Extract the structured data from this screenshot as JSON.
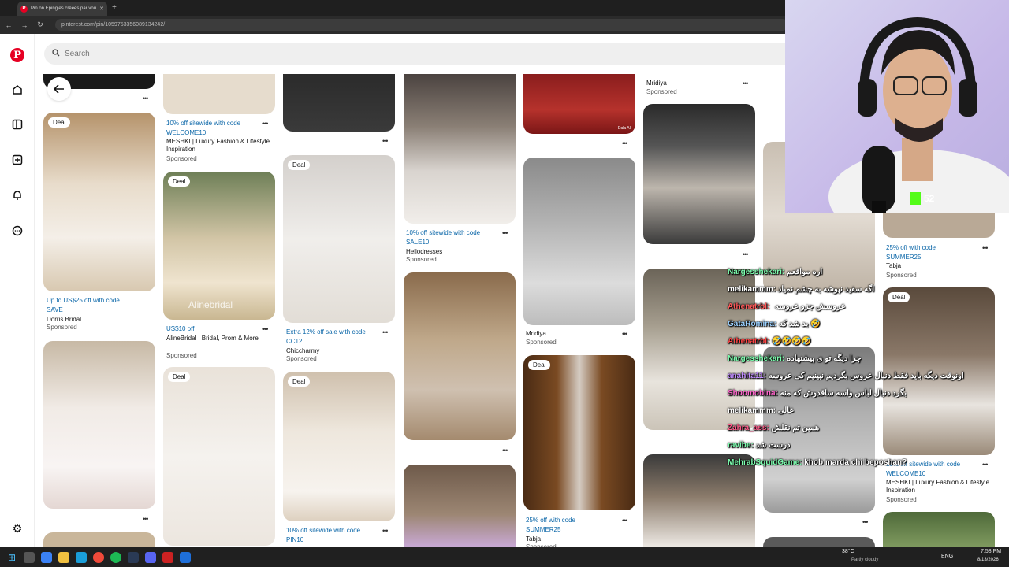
{
  "browser": {
    "tab_title": "Pin on Épingles créées par vous",
    "url": "pinterest.com/pin/1059753356089134242/"
  },
  "search": {
    "placeholder": "Search"
  },
  "pins": [
    {
      "badge": "Deal",
      "promo": "Up to US$25 off with code",
      "code": "SAVE",
      "name": "Dorris Bridal",
      "sponsored": "Sponsored"
    },
    {
      "promo": "10% off sitewide with code",
      "code": "WELCOME10",
      "name": "MESHKI | Luxury Fashion & Lifestyle Inspiration",
      "sponsored": "Sponsored"
    },
    {
      "badge": "Deal",
      "promo": "US$10 off",
      "name": "AlineBridal | Bridal, Prom & More",
      "sponsored": "Sponsored",
      "watermark": "Alinebridal"
    },
    {
      "badge": "Deal",
      "promo": "Extra 12% off sale with code",
      "code": "CC12",
      "name": "Chiccharmy",
      "sponsored": "Sponsored"
    },
    {
      "badge": "Deal"
    },
    {
      "badge": "Deal",
      "promo": "10% off sitewide with code",
      "code": "PIN10"
    },
    {
      "promo": "10% off sitewide with code",
      "code": "SALE10",
      "name": "Hellodresses",
      "sponsored": "Sponsored"
    },
    {
      "name": "Mridiya",
      "sponsored": "Sponsored",
      "watermark": "Dala AI"
    },
    {
      "name": "Mridiya",
      "sponsored": "Sponsored"
    },
    {
      "badge": "Deal",
      "promo": "25% off with code",
      "code": "SUMMER25",
      "name": "Tabja",
      "sponsored": "Sponsored"
    },
    {
      "promo": "25% off with code",
      "code": "SUMMER25",
      "name": "Tabja",
      "sponsored": "Sponsored"
    },
    {
      "badge": "Deal",
      "promo": "10% off sitewide with code",
      "code": "WELCOME10",
      "name": "MESHKI | Luxury Fashion & Lifestyle Inspiration",
      "sponsored": "Sponsored"
    }
  ],
  "webcam": {
    "badge": "52"
  },
  "chat": [
    {
      "user": "Nargesshekari:",
      "msg": "اره مواقعم",
      "color": "#7dffb0"
    },
    {
      "user": "melikammm:",
      "msg": "اگه سفید نپوشه به چشم نمیاد",
      "color": "#ffffff"
    },
    {
      "user": "",
      "msg": "عروسش جزو عروسه",
      "color": "#ffffff"
    },
    {
      "user": "Athenatrbl:",
      "msg": "",
      "color": "#ff5a5a"
    },
    {
      "user": "GataRomina:",
      "msg": "بد شد که",
      "color": "#9ad0ff"
    },
    {
      "user": "Athenatrbl:",
      "msg": "",
      "color": "#ff4444"
    },
    {
      "user": "Nargesshekari:",
      "msg": "چرا دیگه تو ی پیشنهاده",
      "color": "#7dffb0"
    },
    {
      "user": "anahita11:",
      "msg": "اونوقت دیگه باید فقط دنبال عروس بگردیم نبینیم کی عروسه",
      "color": "#c08cff"
    },
    {
      "user": "Shoomobina:",
      "msg": "بگرد دنبال لباس واسه ساقدوش که منه",
      "color": "#ff66cc"
    },
    {
      "user": "melikammm:",
      "msg": "عالی",
      "color": "#ffffff"
    },
    {
      "user": "Zahra_ass:",
      "msg": "همین تم نقلش",
      "color": "#ff5a8a"
    },
    {
      "user": "ravibe:",
      "msg": "درست شد",
      "color": "#7dffb0"
    },
    {
      "user": "MehrabSquidGame:",
      "msg": "khob marda chi beposhan?",
      "color": "#7dffb0"
    }
  ],
  "taskbar": {
    "weather_temp": "38°C",
    "weather_desc": "Partly cloudy",
    "lang": "ENG",
    "time": "7:58 PM",
    "date": "8/13/2026"
  }
}
